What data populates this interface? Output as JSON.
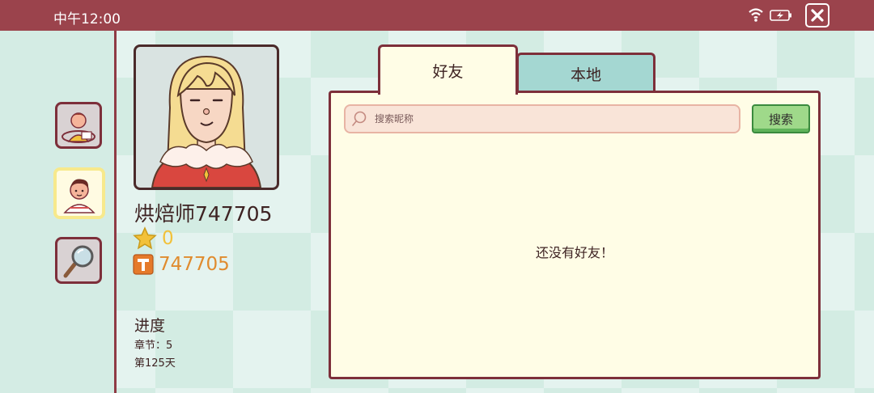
{
  "status_bar": {
    "time": "中午12:00"
  },
  "sidebar": {
    "items": [
      {
        "name": "order-scene"
      },
      {
        "name": "profile",
        "active": true
      },
      {
        "name": "search"
      }
    ]
  },
  "profile": {
    "username": "烘焙师747705",
    "stars": "0",
    "id_value": "747705",
    "progress": {
      "title": "进度",
      "chapter": "章节：5",
      "day": "第125天"
    }
  },
  "tabs": {
    "friends": "好友",
    "local": "本地"
  },
  "search": {
    "placeholder": "搜索昵称",
    "button": "搜索"
  },
  "empty_message": "还没有好友！",
  "colors": {
    "status_bar": "#9b434c",
    "border": "#7d2f3a",
    "panel_bg": "#fffde6",
    "search_button": "#9fd98a",
    "star": "#f2c13a",
    "id_orange": "#e08b2e"
  }
}
